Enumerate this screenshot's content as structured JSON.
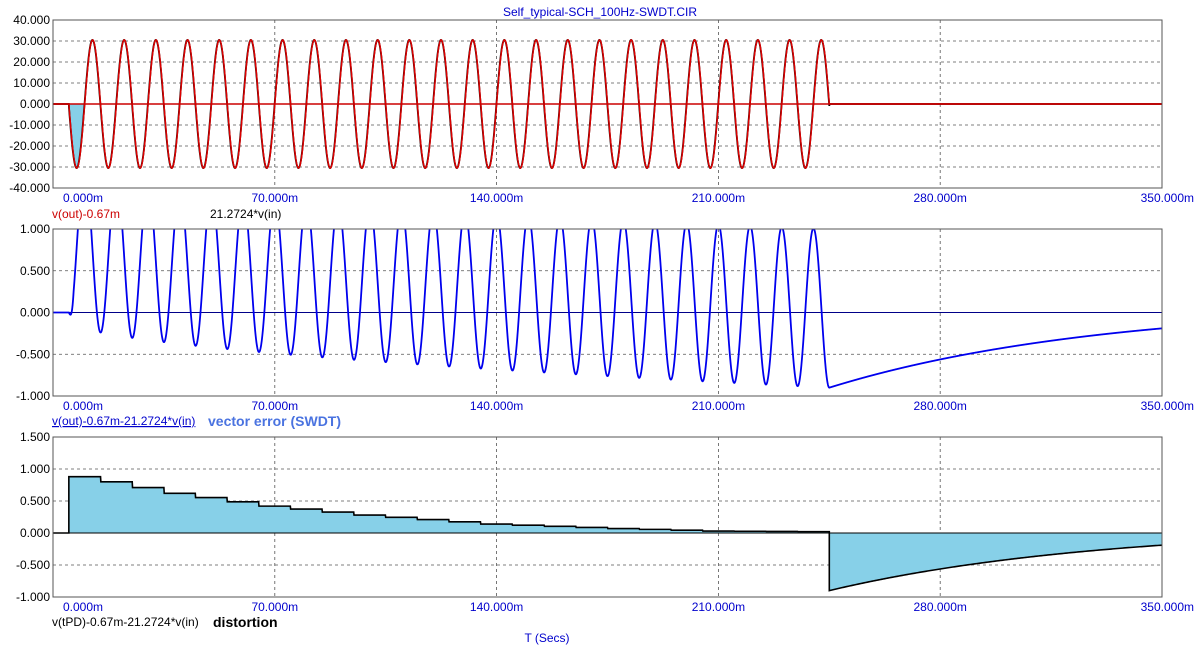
{
  "title": "Self_typical-SCH_100Hz-SWDT.CIR",
  "x_axis_label": "T (Secs)",
  "colors": {
    "vout": "#dd0000",
    "vin": "#000000",
    "error": "#0000ee",
    "fill": "#87d0e8",
    "axis_text": "#0000cc"
  },
  "chart_data": [
    {
      "type": "line",
      "title": "Self_typical-SCH_100Hz-SWDT.CIR",
      "xlim": [
        0,
        0.35
      ],
      "ylim": [
        -40,
        40
      ],
      "x_ticks": [
        "0.000m",
        "70.000m",
        "140.000m",
        "210.000m",
        "280.000m",
        "350.000m"
      ],
      "y_ticks": [
        "40.000",
        "30.000",
        "20.000",
        "10.000",
        "0.000",
        "-10.000",
        "-20.000",
        "-30.000",
        "-40.000"
      ],
      "grid": true,
      "series": [
        {
          "name": "v(out)-0.67m",
          "color": "#dd0000",
          "frequency_hz": 100,
          "amplitude": 30.5,
          "start_s": 0.005,
          "end_s": 0.245
        },
        {
          "name": "21.2724*v(in)",
          "color": "#000000",
          "frequency_hz": 100,
          "amplitude": 30.5,
          "start_s": 0.005,
          "end_s": 0.245
        }
      ],
      "legend": [
        "v(out)-0.67m",
        "21.2724*v(in)"
      ]
    },
    {
      "type": "line",
      "xlim": [
        0,
        0.35
      ],
      "ylim": [
        -1,
        1
      ],
      "x_ticks": [
        "0.000m",
        "70.000m",
        "140.000m",
        "210.000m",
        "280.000m",
        "350.000m"
      ],
      "y_ticks": [
        "1.000",
        "0.500",
        "0.000",
        "-0.500",
        "-1.000"
      ],
      "grid": true,
      "series": [
        {
          "name": "v(out)-0.67m-21.2724*v(in)",
          "color": "#0000ee",
          "frequency_hz": 100,
          "amplitude": 1.5,
          "start_s": 0.005,
          "end_s": 0.245,
          "min_at_start": -0.1,
          "min_at_end": -0.9,
          "end_value": -0.9,
          "value_at_350m": -0.19
        }
      ],
      "annotation": "vector error (SWDT)"
    },
    {
      "type": "area",
      "xlim": [
        0,
        0.35
      ],
      "ylim": [
        -1,
        1.5
      ],
      "x_ticks": [
        "0.000m",
        "70.000m",
        "140.000m",
        "210.000m",
        "280.000m",
        "350.000m"
      ],
      "y_ticks": [
        "1.500",
        "1.000",
        "0.500",
        "0.000",
        "-0.500",
        "-1.000"
      ],
      "grid": true,
      "series": [
        {
          "name": "v(tPD)-0.67m-21.2724*v(in)",
          "color": "#000000",
          "fill": "#87d0e8",
          "x": [
            0.005,
            0.02,
            0.04,
            0.07,
            0.1,
            0.14,
            0.18,
            0.21,
            0.245,
            0.245,
            0.28,
            0.31,
            0.35
          ],
          "y": [
            0.92,
            0.8,
            0.62,
            0.42,
            0.28,
            0.14,
            0.07,
            0.03,
            0.02,
            -0.9,
            -0.55,
            -0.35,
            -0.19
          ]
        }
      ],
      "annotation": "distortion"
    }
  ]
}
